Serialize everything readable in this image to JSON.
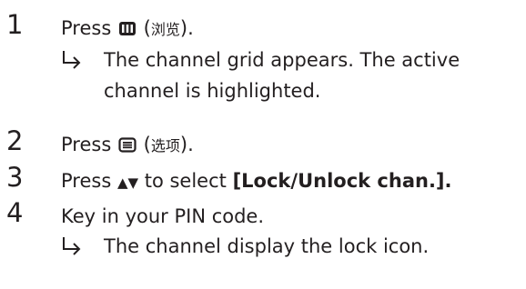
{
  "steps": [
    {
      "number": "1",
      "press_label": "Press",
      "key_icon": "grid-key-icon",
      "chinese": "浏览",
      "sub": "The channel grid appears. The active",
      "sub2": "channel is highlighted."
    },
    {
      "number": "2",
      "press_label": "Press",
      "key_icon": "options-key-icon",
      "chinese": "选项"
    },
    {
      "number": "3",
      "press_label": "Press",
      "nav_symbols": "▲▼",
      "to_select": "to select",
      "option": "[Lock/Unlock chan.]."
    },
    {
      "number": "4",
      "text": "Key in your PIN code.",
      "sub": "The channel display the lock icon."
    }
  ],
  "arrow_icon": "right-hook-arrow-icon"
}
